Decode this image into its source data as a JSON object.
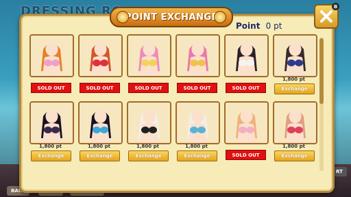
{
  "background": {
    "title": "DRESSING RO",
    "bottom_buttons": [
      "BACK",
      "POINT",
      "DIORAMA"
    ],
    "rt_label": "RT"
  },
  "dialog": {
    "title": "POINT EXCHANGE",
    "close_badge": "B",
    "points_label": "Point",
    "points_value": "0 pt"
  },
  "items": [
    {
      "status": "SOLD OUT",
      "price": "",
      "button": "",
      "hair": "#e6802a",
      "outfit": "#f0a0c8"
    },
    {
      "status": "SOLD OUT",
      "price": "",
      "button": "",
      "hair": "#d4552a",
      "outfit": "#e03040"
    },
    {
      "status": "SOLD OUT",
      "price": "",
      "button": "",
      "hair": "#ef8ab8",
      "outfit": "#f3d25a"
    },
    {
      "status": "SOLD OUT",
      "price": "",
      "button": "",
      "hair": "#ec78a8",
      "outfit": "#f2c24e"
    },
    {
      "status": "SOLD OUT",
      "price": "",
      "button": "",
      "hair": "#2a1f2a",
      "outfit": "#f7f2f2"
    },
    {
      "status": "exchange",
      "price": "1,800 pt",
      "button": "Exchange",
      "hair": "#3a2a2a",
      "outfit": "#2a3c8a"
    },
    {
      "status": "exchange",
      "price": "1,800 pt",
      "button": "Exchange",
      "hair": "#1a1020",
      "outfit": "#3a2a4a"
    },
    {
      "status": "exchange",
      "price": "1,800 pt",
      "button": "Exchange",
      "hair": "#1a1020",
      "outfit": "#3aa8d8"
    },
    {
      "status": "exchange",
      "price": "1,800 pt",
      "button": "Exchange",
      "hair": "#f2efe2",
      "outfit": "#202020"
    },
    {
      "status": "exchange",
      "price": "1,800 pt",
      "button": "Exchange",
      "hair": "#f2efe2",
      "outfit": "#5bb2d6"
    },
    {
      "status": "SOLD OUT",
      "price": "",
      "button": "",
      "hair": "#f0b27a",
      "outfit": "#f3b0c0"
    },
    {
      "status": "exchange",
      "price": "1,800 pt",
      "button": "Exchange",
      "hair": "#e0a080",
      "outfit": "#e0405a"
    }
  ]
}
